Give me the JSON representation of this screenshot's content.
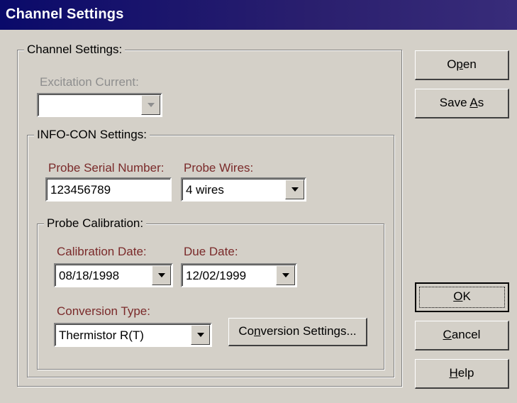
{
  "window": {
    "title": "Channel Settings"
  },
  "channel_group": {
    "label": "Channel Settings:"
  },
  "excitation": {
    "label": "Excitation Current:",
    "value": ""
  },
  "infocon_group": {
    "label": "INFO-CON Settings:"
  },
  "probe_serial": {
    "label": "Probe Serial Number:",
    "value": "123456789"
  },
  "probe_wires": {
    "label": "Probe Wires:",
    "value": "4 wires"
  },
  "calibration_group": {
    "label": "Probe Calibration:"
  },
  "calibration_date": {
    "label": "Calibration Date:",
    "value": "08/18/1998"
  },
  "due_date": {
    "label": "Due Date:",
    "value": "12/02/1999"
  },
  "conversion_type": {
    "label": "Conversion Type:",
    "value": "Thermistor R(T)"
  },
  "buttons": {
    "conversion_settings": {
      "pre": "Co",
      "mn": "n",
      "post": "version Settings..."
    },
    "open": {
      "pre": "O",
      "mn": "p",
      "post": "en"
    },
    "save_as": {
      "pre": "Save ",
      "mn": "A",
      "post": "s"
    },
    "ok": {
      "pre": "",
      "mn": "O",
      "post": "K"
    },
    "cancel": {
      "pre": "",
      "mn": "C",
      "post": "ancel"
    },
    "help": {
      "pre": "",
      "mn": "H",
      "post": "elp"
    }
  }
}
